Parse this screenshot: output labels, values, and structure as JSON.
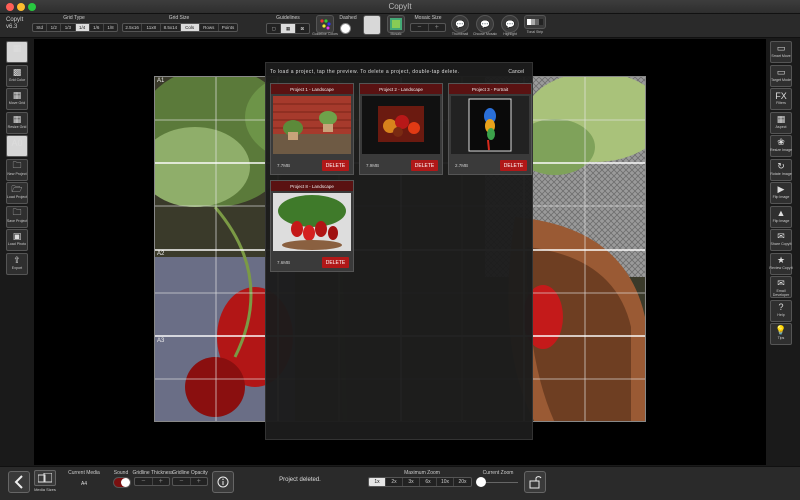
{
  "window": {
    "title": "CopyIt"
  },
  "app": {
    "name": "CopyIt",
    "version": "v6.3"
  },
  "toolbar": {
    "grid_type": {
      "label": "Grid Type",
      "options": [
        "Std",
        "1/2",
        "1/3",
        "1/4",
        "1/6",
        "1/8"
      ],
      "selected": "1/4"
    },
    "grid_size": {
      "label": "Grid Size",
      "options": [
        "2.5x16",
        "11x8",
        "8.5x14",
        "Cols",
        "Rows",
        "Points"
      ],
      "selected": "Cols"
    },
    "guidelines": {
      "label": "Guidelines"
    },
    "guideline_colors": {
      "label": "Guideline Colors"
    },
    "dashed": {
      "label": "Dashed"
    },
    "mosaic_size": {
      "label": "Mosaic Size",
      "button": "Mosaic"
    },
    "thumbnail": {
      "label": "Thumbnail"
    },
    "choose_mosaic": {
      "label": "Choose Mosaic"
    },
    "highlighted": {
      "label": "Highlight"
    },
    "tonal_strip": {
      "label": "Tonal Strip"
    },
    "minus": "−",
    "plus": "+"
  },
  "left_sidebar": [
    {
      "label": "",
      "icon": "grid-icon"
    },
    {
      "label": "Grid Color",
      "icon": "palette-icon"
    },
    {
      "label": "Move Grid",
      "icon": "move-grid-icon"
    },
    {
      "label": "Resize Grid",
      "icon": "resize-grid-icon"
    },
    {
      "label": "A0",
      "icon": "label-icon"
    },
    {
      "label": "New Project",
      "icon": "folder-icon"
    },
    {
      "label": "Load Project",
      "icon": "folder-open-icon"
    },
    {
      "label": "Save Project",
      "icon": "save-folder-icon"
    },
    {
      "label": "Load Photo",
      "icon": "photo-icon"
    },
    {
      "label": "Export",
      "icon": "export-icon"
    }
  ],
  "right_sidebar": [
    {
      "label": "Smart Move",
      "icon": "smart-move-icon"
    },
    {
      "label": "Target Mode",
      "icon": "target-icon"
    },
    {
      "label": "Filters",
      "icon": "fx-icon",
      "glyph": "FX"
    },
    {
      "label": "Aspect",
      "icon": "aspect-icon"
    },
    {
      "label": "Resize Image",
      "icon": "resize-image-icon"
    },
    {
      "label": "Rotate Image",
      "icon": "rotate-icon"
    },
    {
      "label": "Flip Image",
      "icon": "flip-icon"
    },
    {
      "label": "Flip Image",
      "icon": "flip-vertical-icon"
    },
    {
      "label": "Share CopyIt",
      "icon": "share-icon"
    },
    {
      "label": "Review CopyIt",
      "icon": "review-icon"
    },
    {
      "label": "Email Developer",
      "icon": "mail-icon"
    },
    {
      "label": "Help",
      "icon": "help-icon"
    },
    {
      "label": "Tips",
      "icon": "lightbulb-icon"
    }
  ],
  "grid_labels": [
    "A1",
    "A2",
    "A3"
  ],
  "dialog": {
    "message": "To load a project, tap the preview. To delete a project, double-tap delete.",
    "cancel": "Cancel",
    "projects": [
      {
        "title": "Project 1 - Landscape",
        "size": "7.7MB",
        "delete": "DELETE",
        "thumb": "porch-plants"
      },
      {
        "title": "Project 2 - Landscape",
        "size": "7.9MB",
        "delete": "DELETE",
        "thumb": "fruit-bowl"
      },
      {
        "title": "Project 3 - Portrait",
        "size": "2.7MB",
        "delete": "DELETE",
        "thumb": "parrot"
      },
      {
        "title": "Project 8 - Landscape",
        "size": "7.6MB",
        "delete": "DELETE",
        "thumb": "strawberries"
      }
    ]
  },
  "bottom": {
    "media_sizes": "Media Sizes",
    "current_media_label": "Current Media",
    "current_media_value": "A4",
    "sound_label": "Sound",
    "gridline_thickness_label": "Gridline Thickness",
    "gridline_opacity_label": "Gridline Opacity",
    "status": "Project deleted.",
    "maximum_zoom_label": "Maximum Zoom",
    "zoom_options": [
      "1x",
      "2x",
      "3x",
      "6x",
      "10x",
      "20x"
    ],
    "zoom_selected": "1x",
    "current_zoom_label": "Current Zoom",
    "minus": "−",
    "plus": "+"
  },
  "colors": {
    "delete_red": "#b01818",
    "card_header": "#5a1212",
    "background": "#000000"
  }
}
